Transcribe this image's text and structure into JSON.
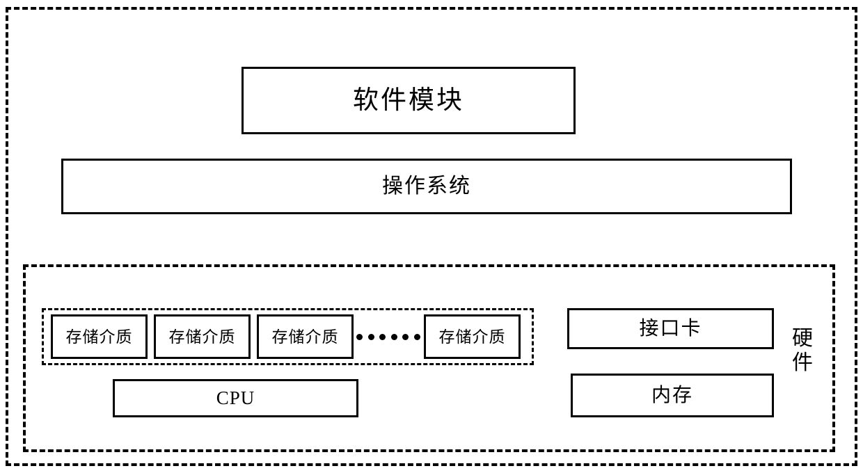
{
  "diagram": {
    "outer_frame": {
      "name": "system-boundary",
      "style": "dashed"
    },
    "layers": {
      "software_module": {
        "label": "软件模块"
      },
      "operating_system": {
        "label": "操作系统"
      },
      "hardware": {
        "label": "硬件",
        "label_chars": [
          "硬",
          "件"
        ],
        "storage_group": {
          "items": [
            {
              "label": "存储介质"
            },
            {
              "label": "存储介质"
            },
            {
              "label": "存储介质"
            },
            {
              "label": "存储介质"
            }
          ],
          "ellipsis_dots": 6
        },
        "cpu": {
          "label": "CPU"
        },
        "interface_card": {
          "label": "接口卡"
        },
        "memory": {
          "label": "内存"
        }
      }
    },
    "colors": {
      "line": "#000000",
      "background": "#ffffff",
      "text": "#000000"
    }
  }
}
